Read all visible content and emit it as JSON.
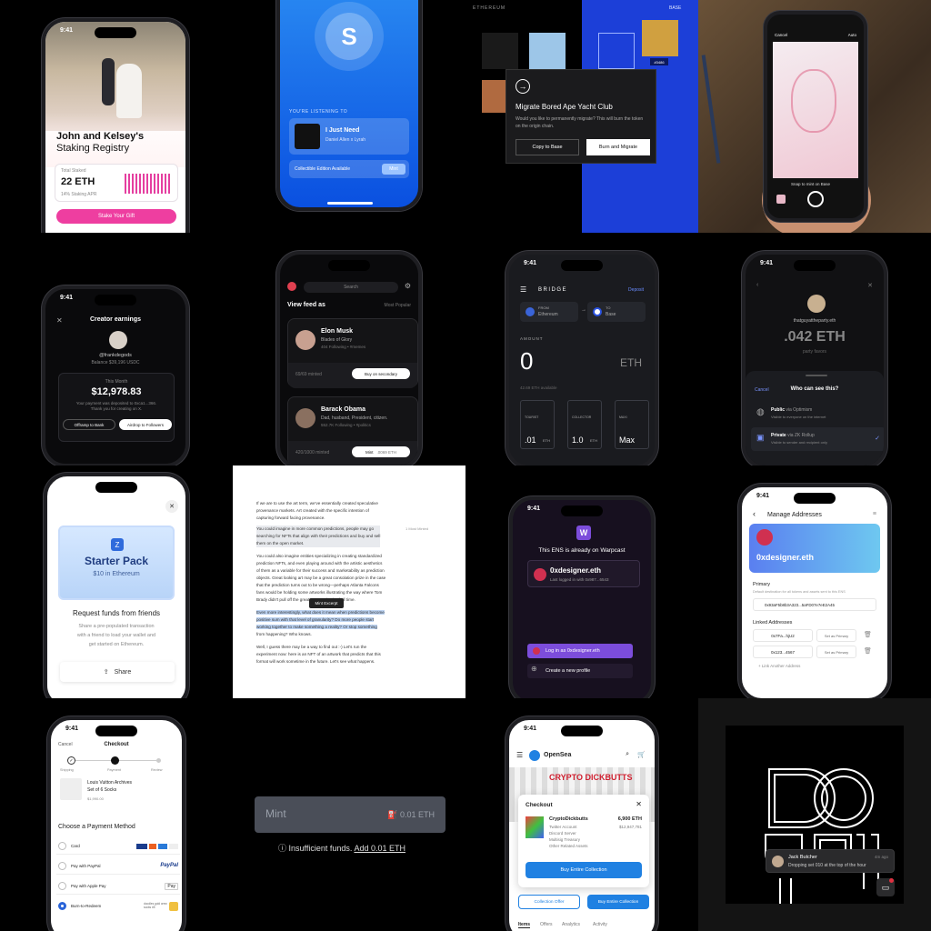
{
  "t1": {
    "time": "9:41",
    "title": "John and Kelsey's",
    "subtitle": "Staking Registry",
    "total_label": "Total Staked",
    "amount": "22 ETH",
    "apr": "14% Staking APR",
    "cta": "Stake Your Gift"
  },
  "t2": {
    "listening": "YOU'RE LISTENING TO",
    "song": "I Just Need",
    "artist": "Daniel Allen x Lyrah",
    "edition": "Collectible Edition Available",
    "mint": "Mint"
  },
  "t3": {
    "eth_label": "ETHEREUM",
    "base_label": "BASE",
    "badge": "#3486",
    "title": "Migrate Bored Ape Yacht Club",
    "body": "Would you like to permanently migrate? This will burn the token on the origin chain.",
    "copy": "Copy to Base",
    "burn": "Burn and Migrate"
  },
  "t4": {
    "cancel": "Cancel",
    "auto": "Auto",
    "hint": "Snap to mint on Base"
  },
  "t5": {
    "time": "9:41",
    "title": "Creator earnings",
    "handle": "@frankdegods",
    "balance": "Balance $39,196 USDC",
    "month": "This Month",
    "amount": "$12,978.83",
    "note1": "Your payment was deposited to 0xca1...366.",
    "note2": "Thank you for creating on X.",
    "offramp": "Offramp to Bank",
    "airdrop": "Airdrop to Followers"
  },
  "t6": {
    "search": "Search",
    "feed": "View feed as",
    "sort": "Most Popular",
    "c1": {
      "name": "Elon Musk",
      "desc": "Blades of Glory",
      "stats": "404 Following • #memes",
      "minted": "69/69 minted",
      "action": "Buy on secondary"
    },
    "c2": {
      "name": "Barack Obama",
      "desc": "Dad, husband, President, citizen.",
      "stats": "552.7K Following • #politics",
      "minted": "420/1000 minted",
      "action": "Mint",
      "price": ".0069 ETH"
    }
  },
  "t7": {
    "time": "9:41",
    "title": "BRIDGE",
    "deposit": "Deposit",
    "from": "FROM",
    "from_chain": "Ethereum",
    "to": "TO",
    "to_chain": "Base",
    "amount_label": "AMOUNT",
    "amount": "0",
    "unit": "ETH",
    "available": "42.69 ETH available",
    "tiers": [
      {
        "name": "TOURIST",
        "value": ".01",
        "unit": "ETH"
      },
      {
        "name": "COLLECTOR",
        "value": "1.0",
        "unit": "ETH"
      },
      {
        "name": "MAXI",
        "value": "Max",
        "unit": ""
      }
    ]
  },
  "t8": {
    "time": "9:41",
    "handle": "thatguyattheparty.eth",
    "amount": ".042 ETH",
    "sub": "party favors",
    "cancel": "Cancel",
    "question": "Who can see this?",
    "public": "Public",
    "public_via": "via Optimism",
    "public_desc": "Visible to everyone on the internet",
    "private": "Private",
    "private_via": "via ZK Rollup",
    "private_desc": "Visible to sender and recipient only"
  },
  "t9": {
    "title": "Starter Pack",
    "price": "$10 in Ethereum",
    "heading": "Request funds from friends",
    "body": [
      "Share a pre-populated transaction",
      "with a friend to load your wallet and",
      "get started on Ethereum."
    ],
    "share": "Share"
  },
  "t10": {
    "p1": [
      "If we are to use the art term, we've essentially created speculative",
      "provenance markets. Art created with the specific intention of",
      "capturing forward facing provenance."
    ],
    "p2": [
      "You could imagine in more common predictions, people may go",
      "searching for NFTs that align with their predictions and buy and sell",
      "them on the open market."
    ],
    "most_minted": "1 Most Minted",
    "p3": [
      "You could also imagine entities specializing in creating standardized",
      "prediction NFTs, and even playing around with the artistic aesthetics",
      "of them as a variable for their success and marketability as prediction",
      "objects. Great looking art may be a great consolation prize in the case",
      "that the prediction turns out to be wrong—perhaps Atlanta Falcons",
      "fans would be holding some artworks illustrating the way where Tom",
      "Brady didn't pull off the greatest comeback of all time."
    ],
    "tooltip": "Mint Excerpt",
    "p4": [
      "Even more interestingly, what does it mean when predictions become",
      "positive sum with that level of granularity? Do more people start",
      "working together to make something a reality? Or stop something",
      "from happening? Who knows."
    ],
    "p5": [
      "Well, I guess there may be a way to find out :-) Let's run the",
      "experiment now: here is an NFT of an artwork that predicts that this",
      "format will work sometime in the future. Let's see what happens."
    ]
  },
  "t11": {
    "time": "9:41",
    "logo": "W",
    "notice": "This ENS is already on Warpcast",
    "ens": "0xdesigner.eth",
    "last": "Last logged in with 0x987...6543",
    "login": "Log in as 0xdesigner.eth",
    "create": "Create a new profile"
  },
  "t12": {
    "time": "9:41",
    "title": "Manage Addresses",
    "ens": "0xdesigner.eth",
    "primary": "Primary",
    "primary_desc": "Default destination for all tokens and assets sent to this ENS",
    "primary_addr": "0x93aF5b8b3A323...5aFD07e7eE2A45",
    "linked": "Linked Addresses",
    "l1": "0x7Fa...hjU2",
    "l2": "0x123...4567",
    "set_primary": "Set as Primary",
    "add": "+ Link Another Address"
  },
  "t13": {
    "time": "9:41",
    "cancel": "Cancel",
    "title": "Checkout",
    "steps": [
      "Shipping",
      "Payment",
      "Review"
    ],
    "product": "Louis Vuitton Archives",
    "variant": "Set of 6 Socks",
    "price": "$1,990.00",
    "choose": "Choose a Payment Method",
    "options": [
      "Card",
      "Pay with PayPal",
      "Pay with Apple Pay",
      "Burn-to-Redeem"
    ],
    "paypal": "PayPal",
    "applepay": "Pay",
    "doodles": "doodles gold crew socks #5"
  },
  "t14": {
    "mint": "Mint",
    "price": "0.01 ETH",
    "warning": "Insufficient funds.",
    "add": "Add 0.01 ETH"
  },
  "t15": {
    "time": "9:41",
    "brand": "OpenSea",
    "banner": "CRYPTO DICKBUTTS",
    "checkout": "Checkout",
    "collection": "CryptoDickbutts",
    "lines": [
      "Twitter Account",
      "Discord Server",
      "Multisig Treasury",
      "Other Related Assets"
    ],
    "price": "6,900 ETH",
    "usd": "$12,947,781",
    "buy": "Buy Entire Collection",
    "offer": "Collection Offer",
    "buy2": "Buy Entire Collection",
    "tabs": [
      "Items",
      "Offers",
      "Analytics",
      "Activity"
    ]
  },
  "t16": {
    "name": "Jack Butcher",
    "time": "4m ago",
    "msg": "Dropping set 010 at the top of the hour"
  }
}
